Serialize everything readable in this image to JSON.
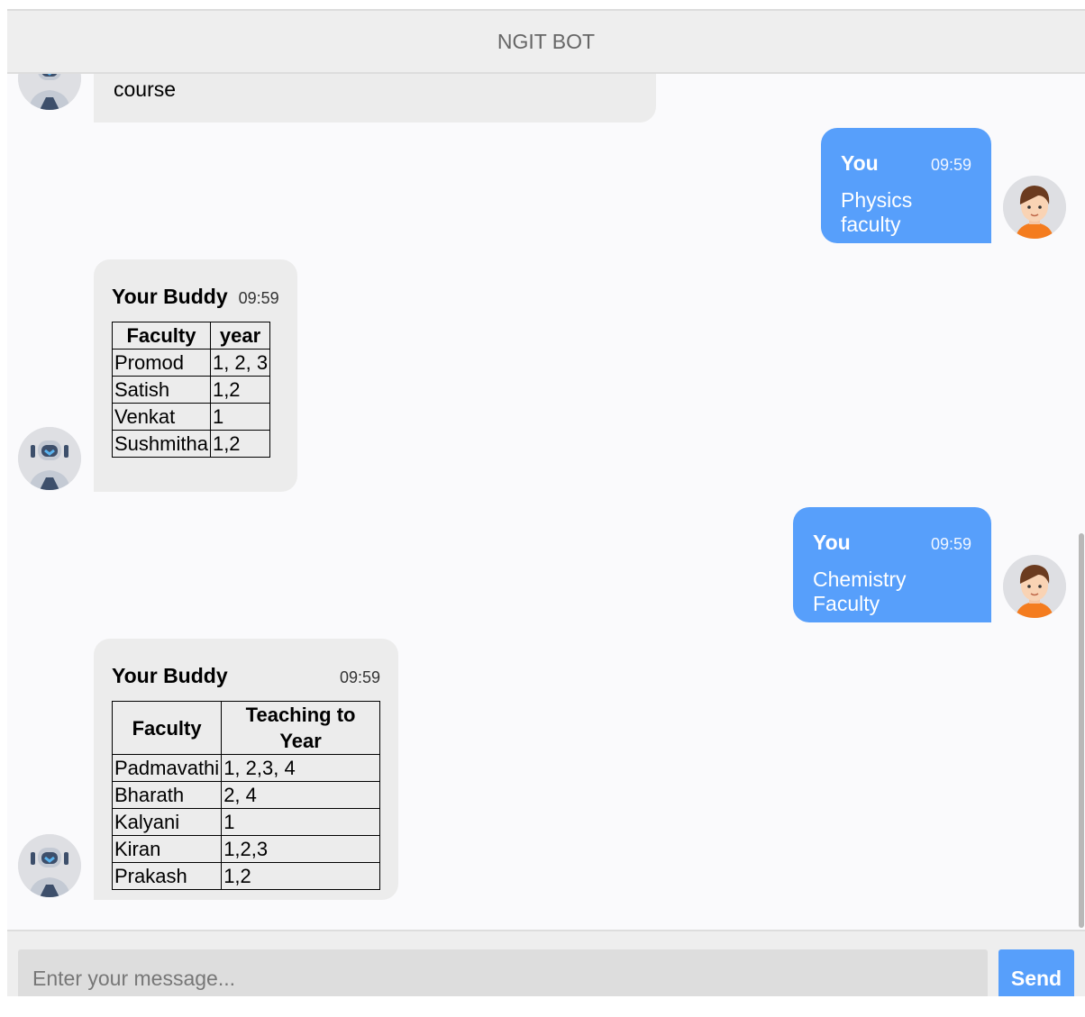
{
  "header": {
    "title": "NGIT BOT"
  },
  "messages": [
    {
      "sender": "bot",
      "text": "course"
    },
    {
      "sender": "user",
      "name": "You",
      "time": "09:59",
      "text": "Physics faculty"
    },
    {
      "sender": "bot",
      "name": "Your Buddy",
      "time": "09:59",
      "table": {
        "headers": [
          "Faculty",
          "year"
        ],
        "rows": [
          [
            "Promod",
            "1, 2, 3"
          ],
          [
            "Satish",
            "1,2"
          ],
          [
            "Venkat",
            "1"
          ],
          [
            "Sushmitha",
            "1,2"
          ]
        ]
      }
    },
    {
      "sender": "user",
      "name": "You",
      "time": "09:59",
      "text": "Chemistry Faculty"
    },
    {
      "sender": "bot",
      "name": "Your Buddy",
      "time": "09:59",
      "table": {
        "headers": [
          "Faculty",
          "Teaching to Year"
        ],
        "rows": [
          [
            "Padmavathi",
            "1, 2,3, 4"
          ],
          [
            "Bharath",
            "2, 4"
          ],
          [
            "Kalyani",
            "1"
          ],
          [
            "Kiran",
            "1,2,3"
          ],
          [
            "Prakash",
            "1,2"
          ]
        ]
      }
    }
  ],
  "input": {
    "placeholder": "Enter your message...",
    "value": ""
  },
  "send": {
    "label": "Send"
  },
  "colors": {
    "user_bubble": "#579ffb",
    "bot_bubble": "#ececec",
    "header_bg": "#eeeeee"
  },
  "icons": {
    "bot_avatar": "robot-avatar-icon",
    "user_avatar": "boy-avatar-icon"
  }
}
